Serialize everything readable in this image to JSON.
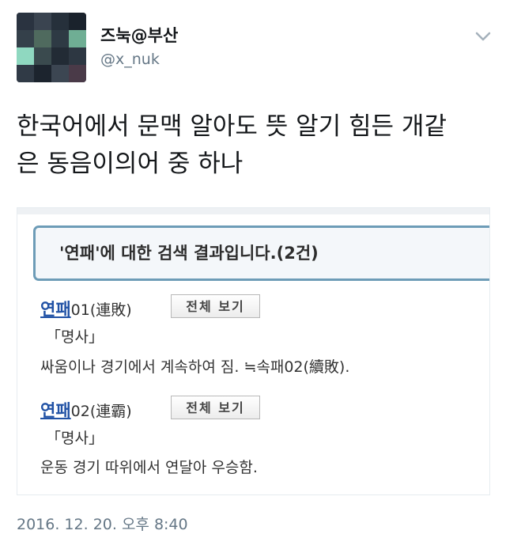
{
  "tweet": {
    "display_name": "즈눅@부산",
    "handle": "@x_nuk",
    "text_line1": "한국어에서 문맥 알아도 뜻 알기 힘든 개같",
    "text_line2": "은 동음이의어 중 하나",
    "timestamp": "2016. 12. 20. 오후 8:40"
  },
  "card": {
    "search_result_title": "'연패'에 대한 검색 결과입니다.(2건)",
    "entries": [
      {
        "headword": "연패",
        "suffix": "01(連敗)",
        "button_label": "전체 보기",
        "pos": "「명사」",
        "definition": "싸움이나 경기에서 계속하여 짐. ≒속패02(續敗)."
      },
      {
        "headword": "연패",
        "suffix": "02(連霸)",
        "button_label": "전체 보기",
        "pos": "「명사」",
        "definition": "운동 경기 따위에서 연달아 우승함."
      }
    ]
  },
  "icons": {
    "menu_caret": "chevron-down-icon"
  },
  "colors": {
    "handle_gray": "#657786",
    "link_blue": "#2152a5",
    "header_border": "#6d9cb7"
  }
}
